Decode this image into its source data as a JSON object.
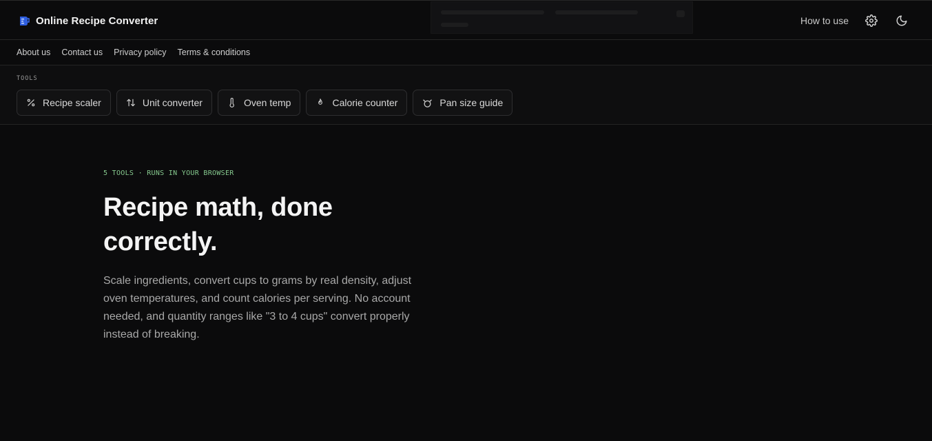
{
  "header": {
    "title": "Online Recipe Converter",
    "how_to_use": "How to use",
    "icons": {
      "brand": "measuring-cup-icon",
      "settings": "gear-icon",
      "theme": "moon-icon"
    }
  },
  "subnav": {
    "items": [
      "About us",
      "Contact us",
      "Privacy policy",
      "Terms & conditions"
    ]
  },
  "tools": {
    "label": "TOOLS",
    "items": [
      {
        "label": "Recipe scaler",
        "icon": "percent-icon"
      },
      {
        "label": "Unit converter",
        "icon": "arrows-up-down-icon"
      },
      {
        "label": "Oven temp",
        "icon": "thermometer-icon"
      },
      {
        "label": "Calorie counter",
        "icon": "flame-icon"
      },
      {
        "label": "Pan size guide",
        "icon": "pan-icon"
      }
    ]
  },
  "hero": {
    "eyebrow": "5 TOOLS · RUNS IN YOUR BROWSER",
    "headline": "Recipe math, done correctly.",
    "lede": "Scale ingredients, convert cups to grams by real density, adjust oven temperatures, and count calories per serving. No account needed, and quantity ranges like \"3 to 4 cups\" convert properly instead of breaking."
  },
  "colors": {
    "background": "#0b0b0c",
    "accent_green": "#86c98e",
    "brand_blue": "#3b6ef5"
  }
}
